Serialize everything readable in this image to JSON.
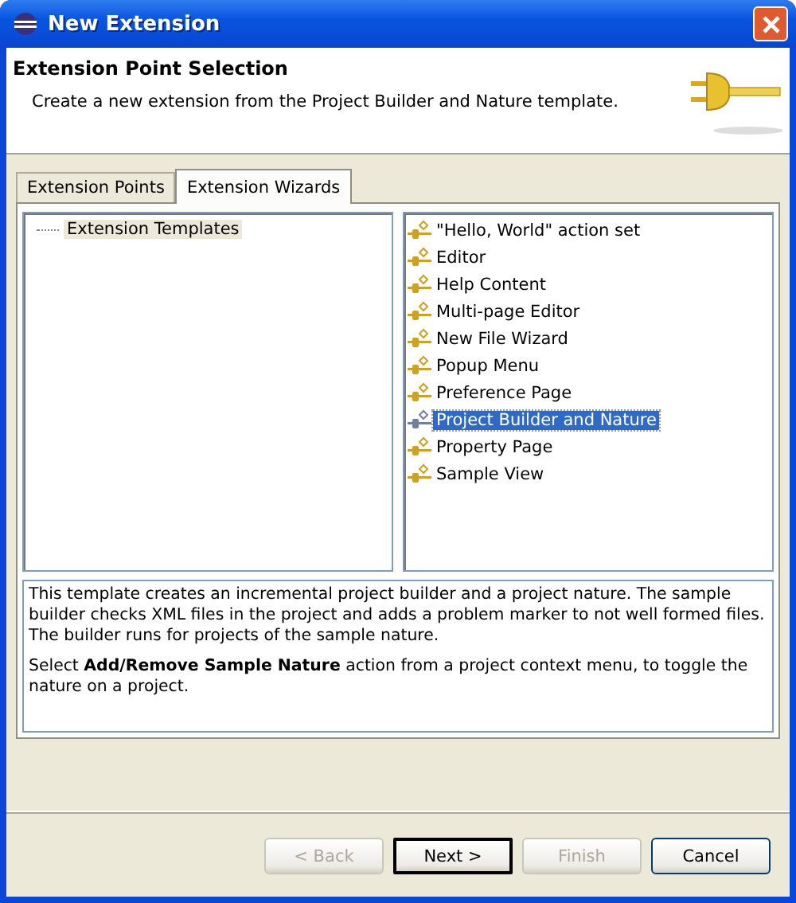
{
  "window": {
    "title": "New Extension"
  },
  "header": {
    "title": "Extension Point Selection",
    "description": "Create a new extension from the Project Builder and Nature template."
  },
  "tabs": [
    {
      "label": "Extension Points",
      "selected": false
    },
    {
      "label": "Extension Wizards",
      "selected": true
    }
  ],
  "tree": {
    "items": [
      {
        "label": "Extension Templates",
        "selected": true
      }
    ]
  },
  "templates": [
    {
      "label": "\"Hello, World\" action set",
      "selected": false
    },
    {
      "label": "Editor",
      "selected": false
    },
    {
      "label": "Help Content",
      "selected": false
    },
    {
      "label": "Multi-page Editor",
      "selected": false
    },
    {
      "label": "New File Wizard",
      "selected": false
    },
    {
      "label": "Popup Menu",
      "selected": false
    },
    {
      "label": "Preference Page",
      "selected": false
    },
    {
      "label": "Project Builder and Nature",
      "selected": true
    },
    {
      "label": "Property Page",
      "selected": false
    },
    {
      "label": "Sample View",
      "selected": false
    }
  ],
  "description": [
    "This template creates an incremental project builder and a project nature. The sample builder checks XML files in the project and adds a problem marker to not well formed files. The builder runs for projects of the sample nature.",
    "Select **Add/Remove Sample Nature** action from a project context menu, to toggle the nature on a project."
  ],
  "buttons": [
    {
      "label": "< Back",
      "disabled": true,
      "default": false
    },
    {
      "label": "Next >",
      "disabled": false,
      "default": true
    },
    {
      "label": "Finish",
      "disabled": true,
      "default": false
    },
    {
      "label": "Cancel",
      "disabled": false,
      "default": false
    }
  ]
}
